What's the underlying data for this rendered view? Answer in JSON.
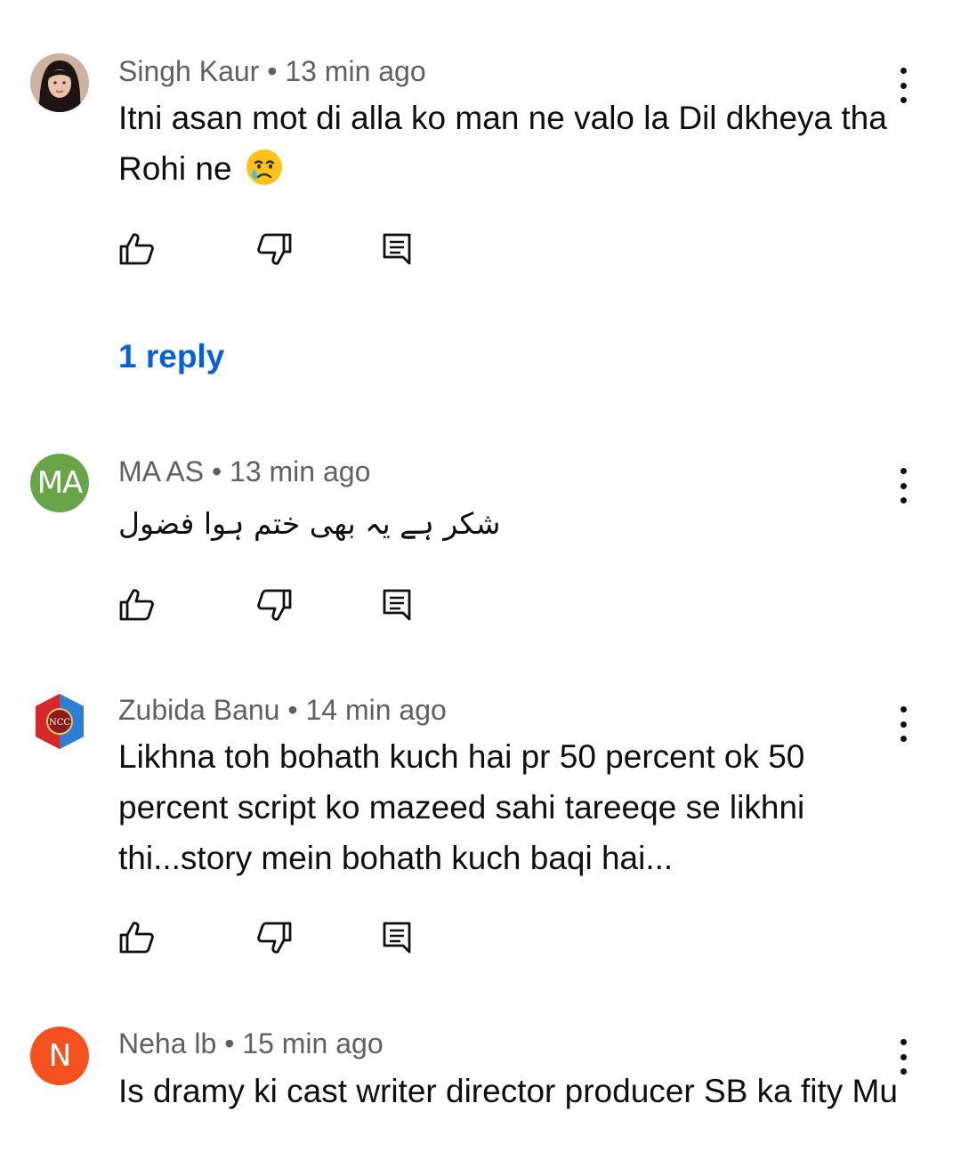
{
  "comments": [
    {
      "author": "Singh Kaur",
      "separator": " • ",
      "time": "13 min ago",
      "text": "Itni asan mot di alla ko man ne valo la Dil dkheya tha Rohi ne",
      "emoji_icon": "crying-face-icon",
      "avatar": {
        "type": "photo",
        "bg": "#d8c3b5"
      },
      "reply_label": "1 reply"
    },
    {
      "author": "MA AS",
      "separator": " • ",
      "time": "13 min ago",
      "text": "شکر ہے یہ بھی ختم ہوا فضول",
      "avatar": {
        "type": "letters",
        "letters": "MA",
        "bg": "#68a548"
      }
    },
    {
      "author": "Zubida Banu",
      "separator": " • ",
      "time": "14 min ago",
      "text": "Likhna toh bohath kuch hai pr 50 percent ok 50 percent script ko mazeed sahi tareeqe se likhni thi...story mein bohath kuch baqi hai...",
      "avatar": {
        "type": "logo",
        "letters": "NCC",
        "bg": "#1f3c8c"
      }
    },
    {
      "author": "Neha lb",
      "separator": " • ",
      "time": "15 min ago",
      "text": "Is dramy ki cast writer director producer SB ka fity Mu",
      "avatar": {
        "type": "letters",
        "letters": "N",
        "bg": "#f4511e"
      }
    }
  ],
  "icons": {
    "like": "thumbs-up-icon",
    "dislike": "thumbs-down-icon",
    "reply": "comment-reply-icon",
    "more": "more-vertical-icon"
  },
  "colors": {
    "link": "#065fd4",
    "meta": "#606060",
    "text": "#0f0f0f"
  }
}
